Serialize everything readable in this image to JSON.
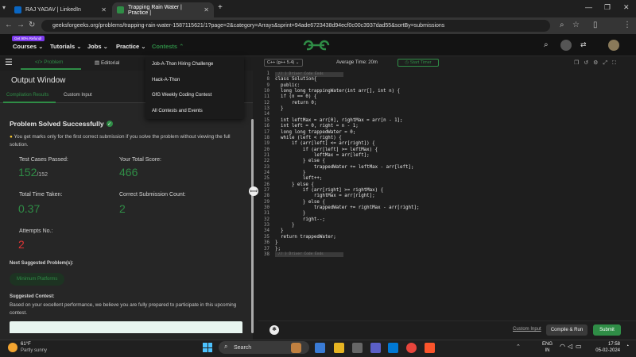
{
  "browser": {
    "tabs": [
      {
        "title": "RAJ YADAV | LinkedIn"
      },
      {
        "title": "Trapping Rain Water | Practice |"
      }
    ],
    "url": "geeksforgeeks.org/problems/trapping-rain-water-1587115621/1?page=2&category=Arrays&sprint=94ade6723438d94ecf0c00c3937dad55&sortBy=submissions",
    "new_tab": "+"
  },
  "header": {
    "badge": "Get 90% Refund!",
    "menus": [
      "Courses",
      "Tutorials",
      "Jobs",
      "Practice",
      "Contests"
    ]
  },
  "dropdown": {
    "items": [
      "Job-A-Thon Hiring Challenge",
      "Hack-A-Thon",
      "GfG Weekly Coding Contest",
      "All Contests and Events"
    ]
  },
  "left_panel": {
    "tabs": [
      "Problem",
      "Editorial"
    ],
    "output_title": "Output Window",
    "subtabs": [
      "Compilation Results",
      "Custom Input"
    ],
    "status": "Problem Solved Successfully",
    "note": "You get marks only for the first correct submission if you solve the problem without viewing the full solution.",
    "stats": {
      "test_cases_label": "Test Cases Passed:",
      "test_cases_value": "152",
      "test_cases_total": "/152",
      "score_label": "Your Total Score:",
      "score_value": "466",
      "time_label": "Total Time Taken:",
      "time_value": "0.37",
      "correct_label": "Correct Submission Count:",
      "correct_value": "2",
      "attempts_label": "Attempts No.:",
      "attempts_value": "2"
    },
    "next_label": "Next Suggested Problem(s):",
    "next_problem": "Minimum Platforms",
    "contest_label": "Suggested Contest:",
    "contest_text": "Based on your excellent performance, we believe you are fully prepared to participate in this upcoming contest."
  },
  "editor": {
    "language": "C++ (g++ 5.4)",
    "avg_time": "Average Time: 20m",
    "timer": "Start Timer",
    "fold_label": "// } Driver Code Ends",
    "lines": [
      {
        "n": "1",
        "t": ""
      },
      {
        "n": "8",
        "t": "class Solution{"
      },
      {
        "n": "9",
        "t": "  public:"
      },
      {
        "n": "10",
        "t": "  long long trappingWater(int arr[], int n) {"
      },
      {
        "n": "11",
        "t": "  if (n == 0) {"
      },
      {
        "n": "12",
        "t": "      return 0;"
      },
      {
        "n": "13",
        "t": "  }"
      },
      {
        "n": "14",
        "t": ""
      },
      {
        "n": "15",
        "t": "  int leftMax = arr[0], rightMax = arr[n - 1];"
      },
      {
        "n": "16",
        "t": "  int left = 0, right = n - 1;"
      },
      {
        "n": "17",
        "t": "  long long trappedWater = 0;"
      },
      {
        "n": "18",
        "t": "  while (left < right) {"
      },
      {
        "n": "19",
        "t": "      if (arr[left] <= arr[right]) {"
      },
      {
        "n": "20",
        "t": "          if (arr[left] >= leftMax) {"
      },
      {
        "n": "21",
        "t": "              leftMax = arr[left];"
      },
      {
        "n": "22",
        "t": "          } else {"
      },
      {
        "n": "23",
        "t": "              trappedWater += leftMax - arr[left];"
      },
      {
        "n": "24",
        "t": "          }"
      },
      {
        "n": "25",
        "t": "          left++;"
      },
      {
        "n": "26",
        "t": "      } else {"
      },
      {
        "n": "27",
        "t": "          if (arr[right] >= rightMax) {"
      },
      {
        "n": "28",
        "t": "              rightMax = arr[right];"
      },
      {
        "n": "29",
        "t": "          } else {"
      },
      {
        "n": "30",
        "t": "              trappedWater += rightMax - arr[right];"
      },
      {
        "n": "31",
        "t": "          }"
      },
      {
        "n": "32",
        "t": "          right--;"
      },
      {
        "n": "33",
        "t": "      }"
      },
      {
        "n": "34",
        "t": "  }"
      },
      {
        "n": "35",
        "t": "  return trappedWater;"
      },
      {
        "n": "36",
        "t": "}"
      },
      {
        "n": "37",
        "t": "};"
      },
      {
        "n": "38",
        "t": ""
      }
    ],
    "custom_input": "Custom Input",
    "compile_run": "Compile & Run",
    "submit": "Submit"
  },
  "taskbar": {
    "weather_temp": "61°F",
    "weather_desc": "Partly sunny",
    "search": "Search",
    "lang": "ENG",
    "region": "IN",
    "time": "17:58",
    "date": "05-02-2024"
  },
  "colors": {
    "accent": "#2f8d46",
    "error": "#e03535"
  }
}
